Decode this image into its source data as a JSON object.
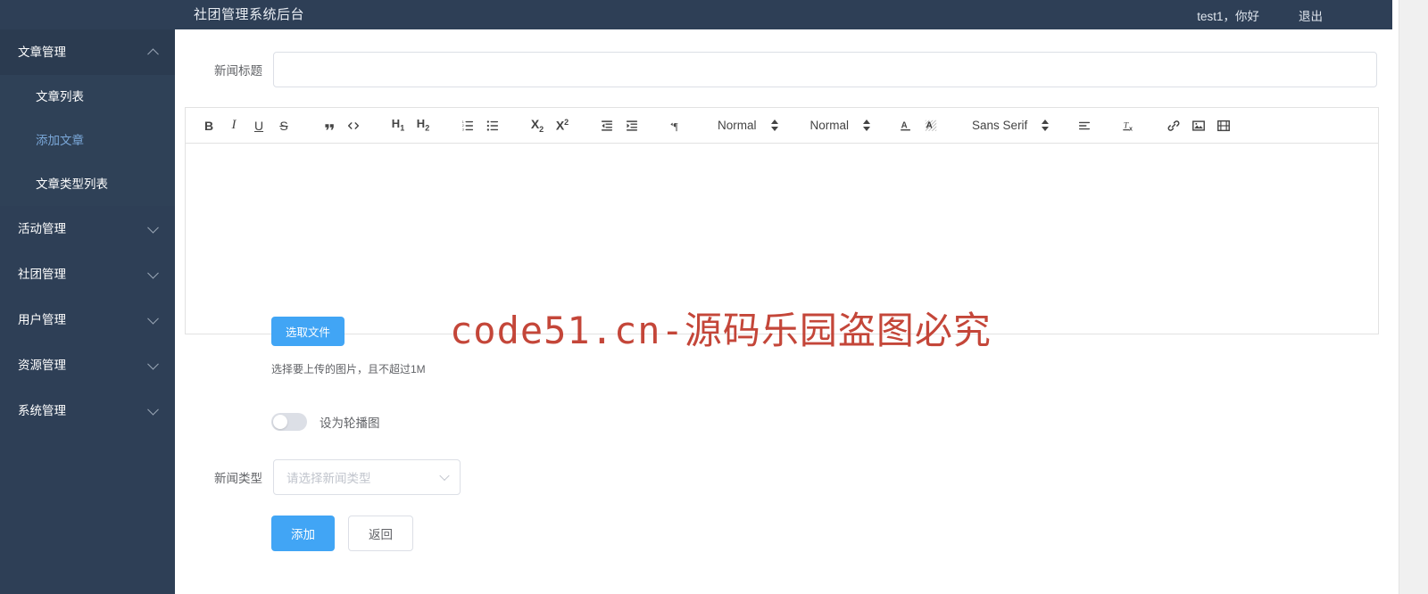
{
  "header": {
    "title": "社团管理系统后台",
    "greeting": "test1，你好",
    "logout": "退出"
  },
  "sidebar": {
    "groups": [
      {
        "label": "文章管理",
        "open": true,
        "caret": "chevron-up-icon",
        "items": [
          {
            "label": "文章列表",
            "active": false
          },
          {
            "label": "添加文章",
            "active": true
          },
          {
            "label": "文章类型列表",
            "active": false
          }
        ]
      },
      {
        "label": "活动管理",
        "open": false,
        "caret": "chevron-down-icon",
        "items": []
      },
      {
        "label": "社团管理",
        "open": false,
        "caret": "chevron-down-icon",
        "items": []
      },
      {
        "label": "用户管理",
        "open": false,
        "caret": "chevron-down-icon",
        "items": []
      },
      {
        "label": "资源管理",
        "open": false,
        "caret": "chevron-down-icon",
        "items": []
      },
      {
        "label": "系统管理",
        "open": false,
        "caret": "chevron-down-icon",
        "items": []
      }
    ]
  },
  "form": {
    "title_label": "新闻标题",
    "title_value": "",
    "title_placeholder": "",
    "upload_button": "选取文件",
    "upload_tip": "选择要上传的图片，且不超过1M",
    "switch_label": "设为轮播图",
    "switch_on": false,
    "type_label": "新闻类型",
    "type_placeholder": "请选择新闻类型",
    "type_value": "",
    "submit_label": "添加",
    "back_label": "返回"
  },
  "editor": {
    "toolbar": {
      "bold": "B",
      "italic": "I",
      "underline": "U",
      "strike": "S",
      "blockquote": "\"",
      "code_block": "</>",
      "header1": "H1",
      "header2": "H2",
      "list_ordered": "ordered-list-icon",
      "list_bullet": "bullet-list-icon",
      "subscript": "X2",
      "superscript": "X2",
      "indent_minus": "outdent-icon",
      "indent_plus": "indent-icon",
      "direction": "text-direction-icon",
      "size_label": "Normal",
      "header_label": "Normal",
      "color": "A",
      "background": "A",
      "font_label": "Sans Serif",
      "align_label": "align-icon",
      "clean": "clear-format-icon",
      "link": "link-icon",
      "image": "image-icon",
      "video": "video-icon"
    },
    "content": ""
  },
  "watermark": {
    "text": "code51.cn-源码乐园盗图必究",
    "color": "#c0392b"
  },
  "colors": {
    "sidebar_bg": "#2e3f56",
    "header_bg": "#2e3f56",
    "accent": "#41a5f5",
    "active_menu": "#7aa7d8"
  }
}
